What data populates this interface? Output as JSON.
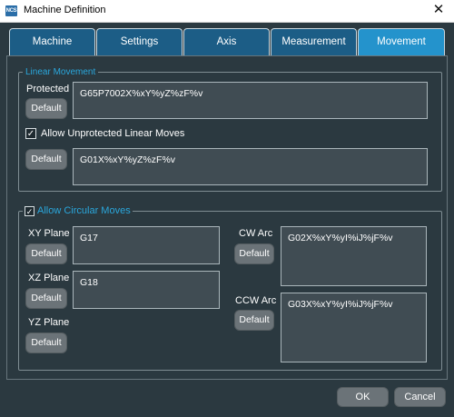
{
  "window": {
    "title": "Machine Definition",
    "icon_text": "NCS",
    "close_glyph": "✕"
  },
  "tabs": [
    "Machine",
    "Settings",
    "Axis",
    "Measurement",
    "Movement"
  ],
  "active_tab": "Movement",
  "linear": {
    "legend": "Linear Movement",
    "protected_label": "Protected",
    "default_label": "Default",
    "protected_value": "G65P7002X%xY%yZ%zF%v",
    "allow_unprotected_label": "Allow Unprotected Linear Moves",
    "allow_unprotected_checked": true,
    "unprotected_value": "G01X%xY%yZ%zF%v"
  },
  "circular": {
    "legend": "Allow Circular Moves",
    "enabled": true,
    "check_glyph": "✓",
    "default_label": "Default",
    "xy_label": "XY Plane",
    "xy_value": "G17",
    "xz_label": "XZ Plane",
    "xz_value": "G18",
    "yz_label": "YZ Plane",
    "cw_label": "CW Arc",
    "cw_value": "G02X%xY%yI%iJ%jF%v",
    "ccw_label": "CCW Arc",
    "ccw_value": "G03X%xY%yI%iJ%jF%v"
  },
  "footer": {
    "ok_label": "OK",
    "cancel_label": "Cancel"
  },
  "colors": {
    "background": "#2b3940",
    "tab": "#1c5d86",
    "tab_active": "#2493cc",
    "legend": "#2aa7dc",
    "button": "#6b7378"
  }
}
